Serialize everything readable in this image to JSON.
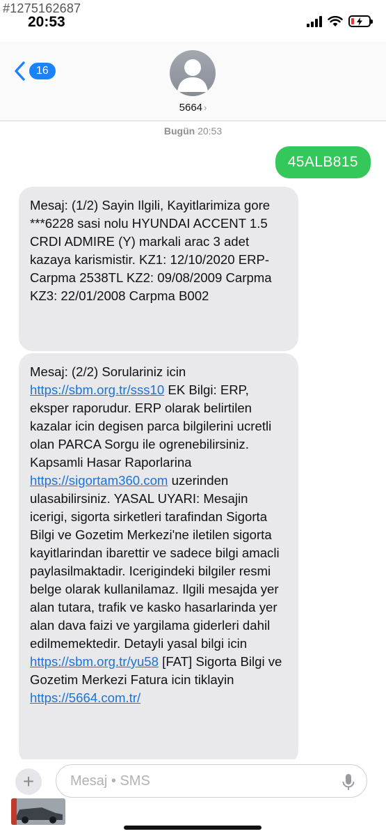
{
  "watermark_id": "#1275162687",
  "status": {
    "time": "20:53"
  },
  "header": {
    "back_count": "16",
    "contact": "5664",
    "contact_chevron": "›"
  },
  "timestamp": {
    "day": "Bugün",
    "time": "20:53"
  },
  "sent_message": "45ALB815",
  "message1": {
    "text": "Mesaj: (1/2) Sayin Ilgili, Kayitlarimiza gore ***6228 sasi nolu HYUNDAI ACCENT 1.5 CRDI ADMIRE (Y) markali arac 3 adet kazaya karismistir. KZ1: 12/10/2020 ERP-Carpma 2538TL KZ2: 09/08/2009 Carpma KZ3: 22/01/2008 Carpma B002"
  },
  "message2": {
    "part1": "Mesaj: (2/2) Sorulariniz icin ",
    "link1": "https://sbm.org.tr/sss10",
    "part2": " EK Bilgi: ERP, eksper raporudur. ERP olarak belirtilen kazalar icin degisen parca bilgilerini ucretli olan PARCA Sorgu ile ogrenebilirsiniz. Kapsamli Hasar Raporlarina ",
    "link2": "https://sigortam360.com",
    "part3": " uzerinden ulasabilirsiniz. YASAL UYARI: Mesajin icerigi, sigorta sirketleri tarafindan Sigorta Bilgi ve Gozetim Merkezi'ne iletilen sigorta kayitlarindan ibarettir ve sadece bilgi amacli paylasilmaktadir. Icerigindeki bilgiler resmi belge olarak kullanilamaz. Ilgili mesajda yer alan tutara, trafik ve kasko hasarlarinda yer alan dava faizi ve yargilama giderleri dahil edilmemektedir. Detayli yasal bilgi icin ",
    "link3": "https://sbm.org.tr/yu58",
    "part4": " [FAT] Sigorta Bilgi ve Gozetim Merkezi Fatura icin tiklayin ",
    "link4": "https://5664.com.tr/"
  },
  "compose": {
    "placeholder": "Mesaj • SMS",
    "plus": "+"
  },
  "icons": {
    "back": "chevron-left-icon",
    "avatar": "person-icon",
    "mic": "microphone-icon",
    "wifi": "wifi-icon",
    "signal": "signal-icon",
    "battery": "battery-icon"
  },
  "colors": {
    "accent": "#1a82fb",
    "sent_bubble": "#34c759",
    "received_bubble": "#e9e9eb",
    "link": "#1a73d9",
    "battery_low": "#e53935"
  }
}
